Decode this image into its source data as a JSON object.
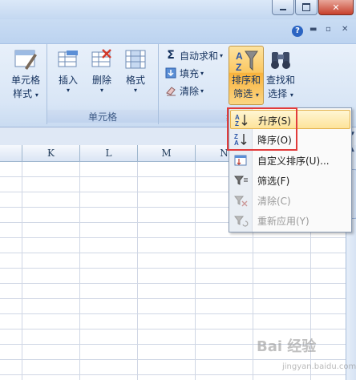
{
  "ribbon": {
    "cells_group": {
      "label": "单元格",
      "style_button": {
        "line1": "单元格",
        "line2": "样式"
      },
      "insert_button": "插入",
      "delete_button": "删除",
      "format_button": "格式"
    },
    "editing_group": {
      "label": "编",
      "autosum_button": "自动求和",
      "fill_button": "填充",
      "clear_button": "清除",
      "sort_filter_button": {
        "line1": "排序和",
        "line2": "筛选"
      },
      "find_select_button": {
        "line1": "查找和",
        "line2": "选择"
      }
    }
  },
  "tabrow": {
    "help_icon": "?"
  },
  "columns": [
    "K",
    "L",
    "M",
    "N"
  ],
  "menu": {
    "items": [
      {
        "label": "升序(S)",
        "icon": "sort-ascending-icon",
        "enabled": true,
        "highlighted": true
      },
      {
        "label": "降序(O)",
        "icon": "sort-descending-icon",
        "enabled": true,
        "highlighted": false
      },
      {
        "label": "自定义排序(U)...",
        "icon": "custom-sort-icon",
        "enabled": true,
        "highlighted": false
      },
      {
        "label": "筛选(F)",
        "icon": "filter-icon",
        "enabled": true,
        "highlighted": false
      },
      {
        "label": "清除(C)",
        "icon": "clear-filter-icon",
        "enabled": false,
        "highlighted": false
      },
      {
        "label": "重新应用(Y)",
        "icon": "reapply-filter-icon",
        "enabled": false,
        "highlighted": false
      }
    ]
  },
  "watermark": {
    "text": "Bai 经验",
    "subtext": "jingyan.baidu.com"
  },
  "colors": {
    "highlight_border": "#e23b3b",
    "hover_fill": "#fde39a",
    "ribbon_bg": "#d9e6f6"
  }
}
